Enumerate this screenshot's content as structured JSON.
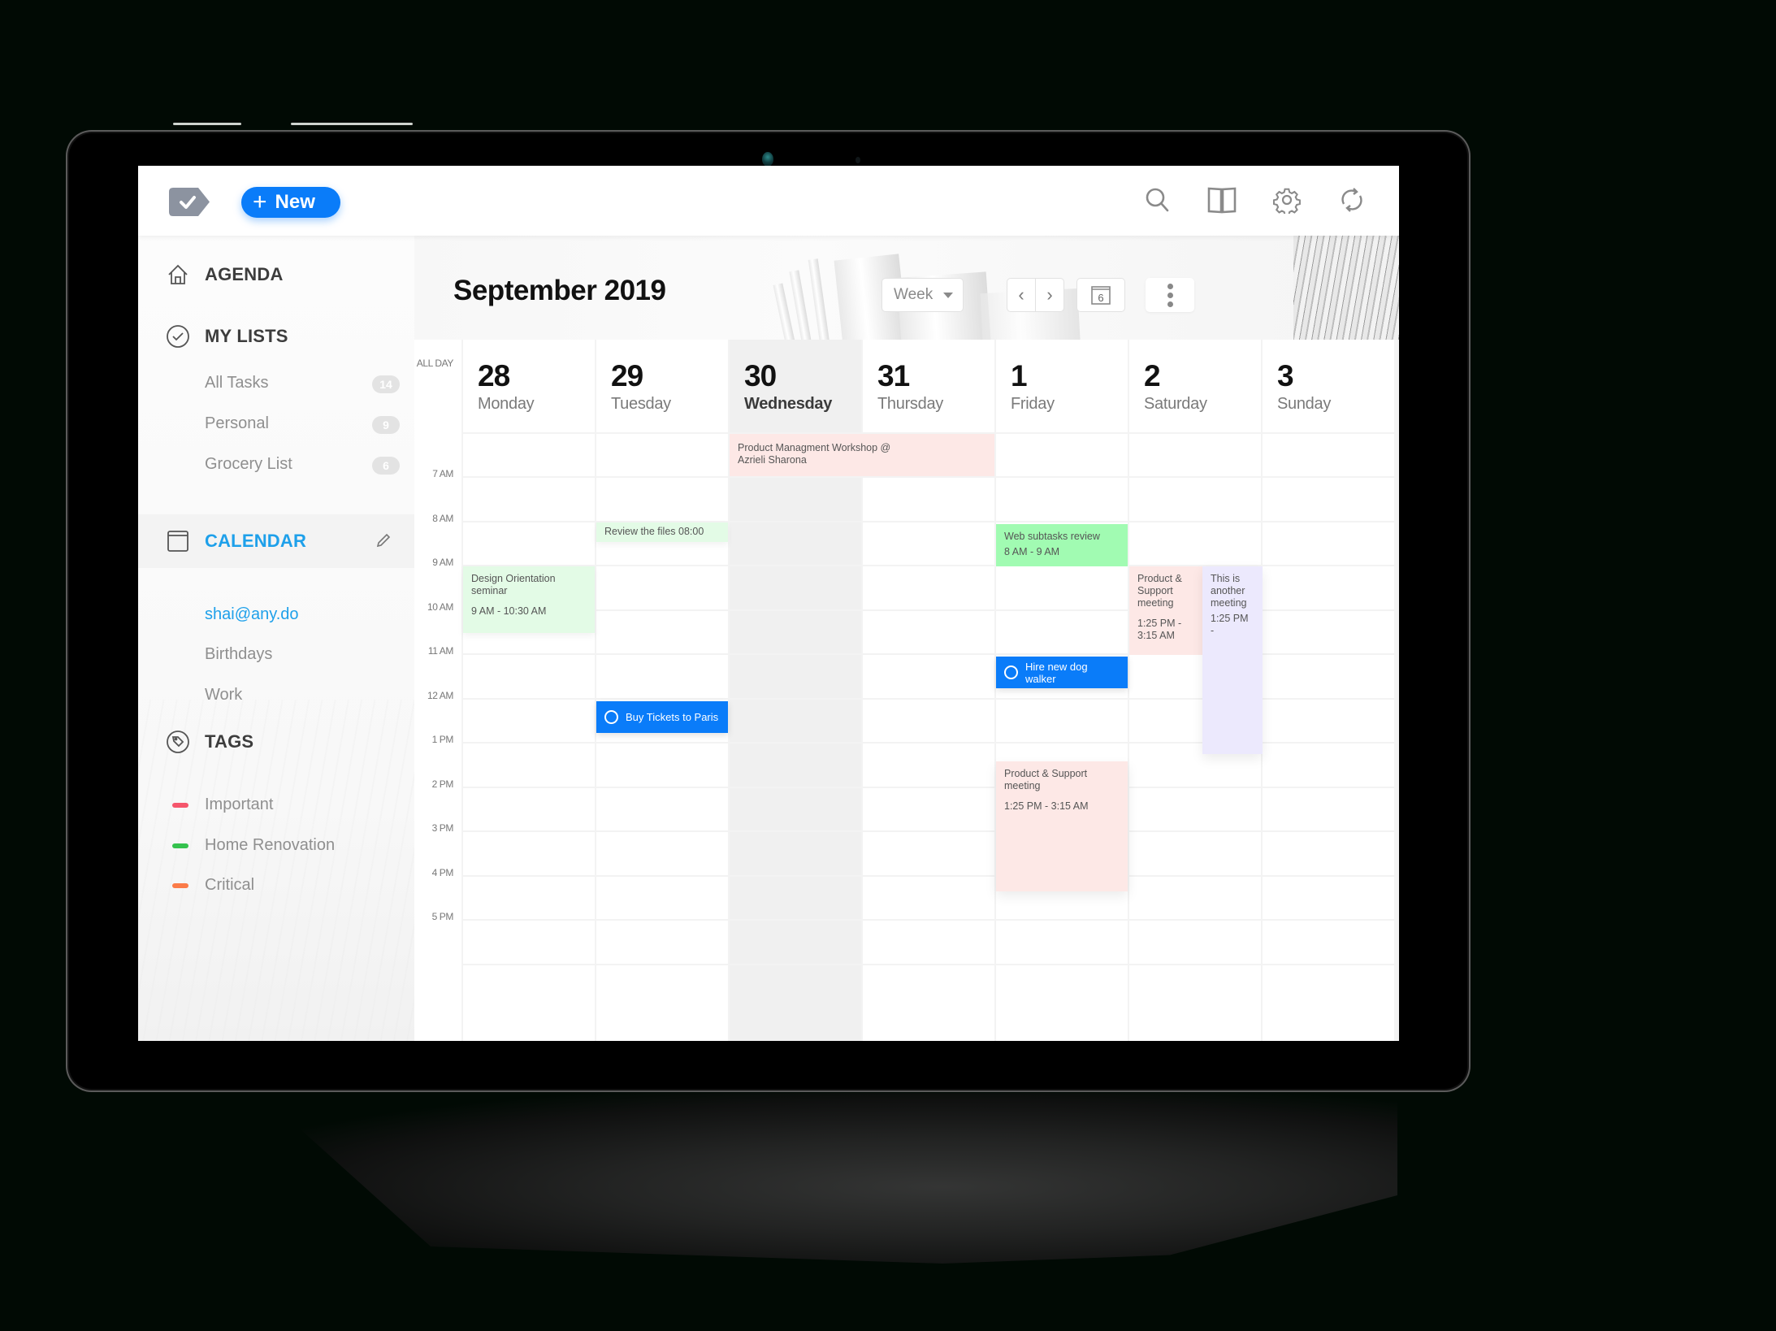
{
  "app": {
    "new_button_label": "New",
    "toolbar_icons": [
      "search-icon",
      "book-icon",
      "gear-icon",
      "sync-icon"
    ]
  },
  "sidebar": {
    "agenda": {
      "label": "AGENDA",
      "icon": "home-icon"
    },
    "my_lists": {
      "label": "MY LISTS",
      "icon": "check-circle-icon",
      "items": [
        {
          "label": "All Tasks",
          "count": "14"
        },
        {
          "label": "Personal",
          "count": "9"
        },
        {
          "label": "Grocery List",
          "count": "6"
        }
      ]
    },
    "calendar": {
      "label": "CALENDAR",
      "icon": "calendar-icon",
      "edit_icon": "pencil-icon",
      "items": [
        {
          "label": "shai@any.do",
          "active": true
        },
        {
          "label": "Birthdays"
        },
        {
          "label": "Work"
        }
      ]
    },
    "tags": {
      "label": "TAGS",
      "icon": "tag-icon",
      "items": [
        {
          "label": "Important",
          "color": "#f5566c"
        },
        {
          "label": "Home Renovation",
          "color": "#35c24e"
        },
        {
          "label": "Critical",
          "color": "#fb7b48"
        }
      ]
    }
  },
  "calendar": {
    "month_title": "September 2019",
    "view_select": "Week",
    "prev_label": "‹",
    "next_label": "›",
    "today_button": "6",
    "days": [
      {
        "num": "28",
        "name": "Monday"
      },
      {
        "num": "29",
        "name": "Tuesday"
      },
      {
        "num": "30",
        "name": "Wednesday",
        "today": true
      },
      {
        "num": "31",
        "name": "Thursday"
      },
      {
        "num": "1",
        "name": "Friday"
      },
      {
        "num": "2",
        "name": "Saturday"
      },
      {
        "num": "3",
        "name": "Sunday"
      }
    ],
    "all_day_label": "ALL DAY",
    "hours": [
      "7 AM",
      "8 AM",
      "9 AM",
      "10 AM",
      "11 AM",
      "12 AM",
      "1 PM",
      "2 PM",
      "3 PM",
      "4 PM",
      "5 PM"
    ],
    "events": {
      "workshop": {
        "title": "Product Managment Workshop @ Azrieli Sharona"
      },
      "review_files": {
        "title": "Review the files 08:00"
      },
      "design_orientation": {
        "title": "Design Orientation seminar",
        "time": "9 AM - 10:30 AM"
      },
      "buy_tickets": {
        "title": "Buy Tickets to Paris"
      },
      "web_subtasks": {
        "title": "Web subtasks review",
        "time": "8 AM - 9 AM"
      },
      "dog_walker": {
        "title": "Hire new dog walker"
      },
      "product_support_fri": {
        "title": "Product & Support meeting",
        "time": "1:25 PM - 3:15 AM"
      },
      "product_support_sat": {
        "title": "Product & Sup­port meeting",
        "time": "1:25 PM - 3:15 AM"
      },
      "another_meeting": {
        "title": "This is another meeting",
        "time": "1:25 PM -"
      }
    }
  }
}
